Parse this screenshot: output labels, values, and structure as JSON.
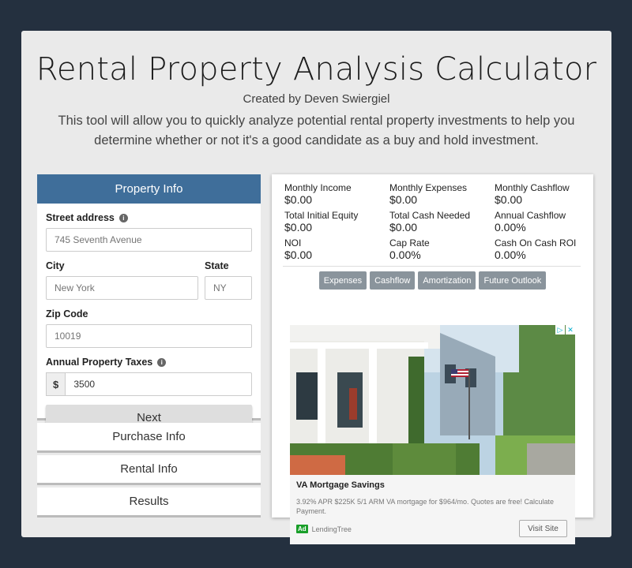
{
  "header": {
    "title": "Rental Property Analysis Calculator",
    "subtitle": "Created by Deven Swiergiel",
    "description": "This tool will allow you to quickly analyze potential rental property investments to help you determine whether or not it's a good candidate as a buy and hold investment."
  },
  "property_info": {
    "heading": "Property Info",
    "street_label": "Street address",
    "street_placeholder": "745 Seventh Avenue",
    "city_label": "City",
    "city_placeholder": "New York",
    "state_label": "State",
    "state_placeholder": "NY",
    "zip_label": "Zip Code",
    "zip_placeholder": "10019",
    "taxes_label": "Annual Property Taxes",
    "taxes_addon": "$",
    "taxes_value": "3500",
    "next_label": "Next",
    "info_icon": "i"
  },
  "sections": [
    "Purchase Info",
    "Rental Info",
    "Results"
  ],
  "metrics": [
    {
      "label": "Monthly Income",
      "value": "$0.00"
    },
    {
      "label": "Monthly Expenses",
      "value": "$0.00"
    },
    {
      "label": "Monthly Cashflow",
      "value": "$0.00"
    },
    {
      "label": "Total Initial Equity",
      "value": "$0.00"
    },
    {
      "label": "Total Cash Needed",
      "value": "$0.00"
    },
    {
      "label": "Annual Cashflow",
      "value": "0.00%"
    },
    {
      "label": "NOI",
      "value": "$0.00"
    },
    {
      "label": "Cap Rate",
      "value": "0.00%"
    },
    {
      "label": "Cash On Cash ROI",
      "value": "0.00%"
    }
  ],
  "tabs": [
    "Expenses",
    "Cashflow",
    "Amortization",
    "Future Outlook"
  ],
  "ad": {
    "title": "VA Mortgage Savings",
    "text": "3.92% APR $225K 5/1 ARM VA mortgage for $964/mo. Quotes are free! Calculate Payment.",
    "ad_mark": "Ad",
    "advertiser": "LendingTree",
    "cta": "Visit Site",
    "choices_icon": "▷",
    "close_icon": "✕"
  },
  "colors": {
    "background": "#24303f",
    "card": "#eaeaea",
    "accordion_header": "#3f6e9a",
    "tab": "#8a949c"
  }
}
